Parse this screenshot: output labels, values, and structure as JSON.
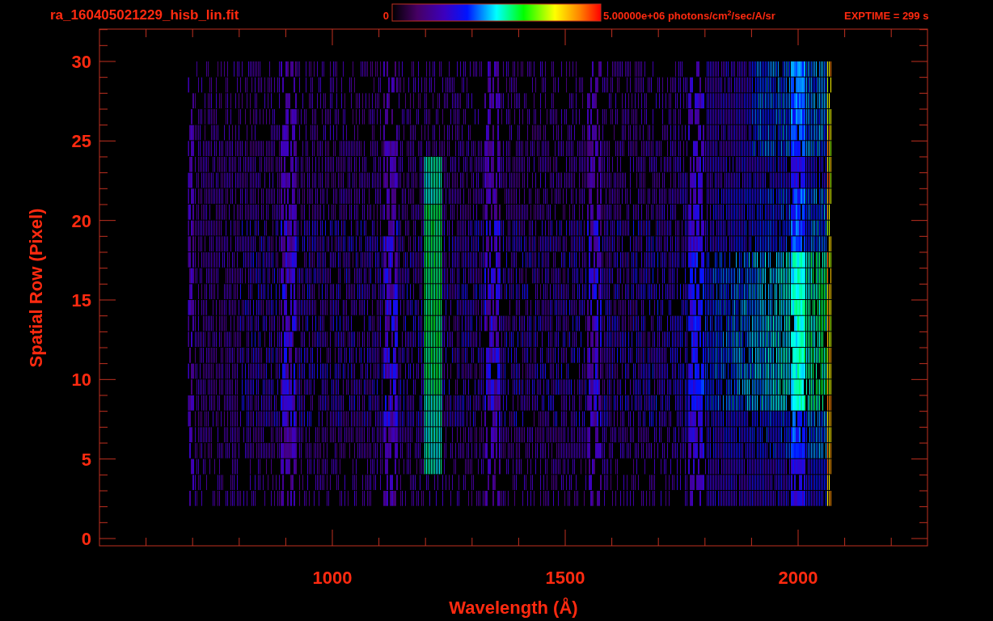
{
  "plot": {
    "title": "ra_160405021229_hisb_lin.fit",
    "colorbar": {
      "min_label": "0",
      "max_label": "5.00000e+06 photons/cm$^{2}$/sec/A/sr"
    },
    "exposure": "EXPTIME = 299 s",
    "y_axis": {
      "title": "Spatial Row (Pixel)",
      "tick_labels": [
        "30",
        "25",
        "20",
        "15",
        "10",
        "5",
        "0"
      ]
    },
    "x_axis": {
      "title": "Wavelength (Å)",
      "tick_labels": [
        "1000",
        "1500",
        "2000"
      ]
    }
  }
}
